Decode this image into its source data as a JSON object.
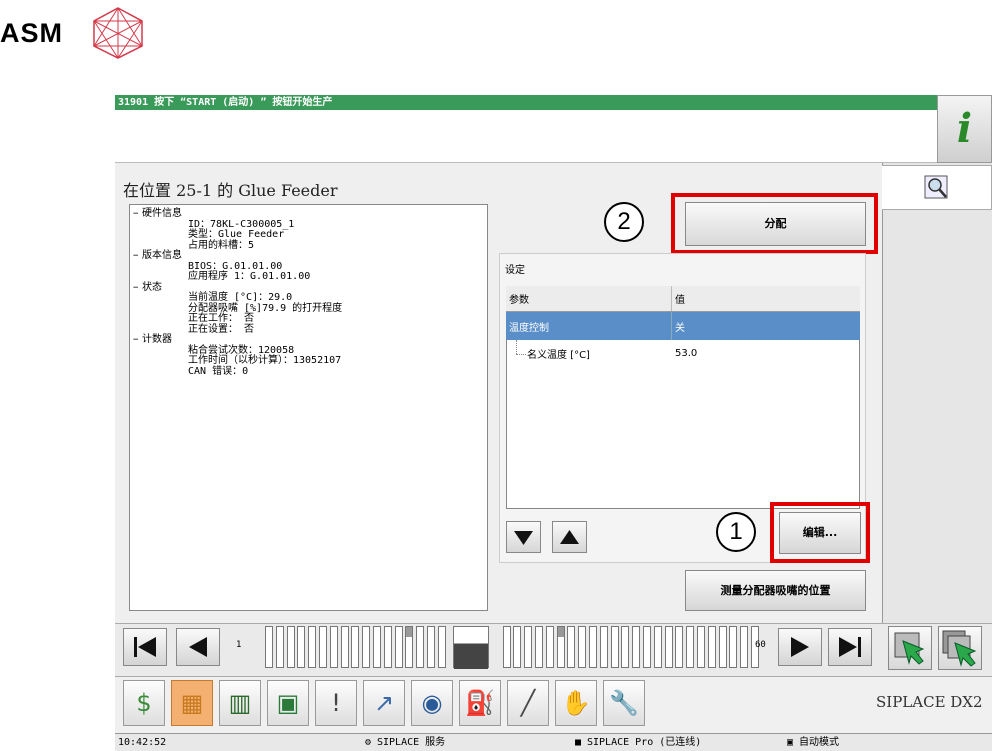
{
  "brand": {
    "name": "ASM"
  },
  "header": {
    "message": "31901 按下 “START (启动) ” 按钮开始生产"
  },
  "panel": {
    "title": "在位置 25-1 的 Glue Feeder"
  },
  "tree": [
    "硬件信息",
    "ID：78KL-C300005_1",
    "类型：Glue Feeder",
    "占用的料槽：5",
    "版本信息",
    "BIOS：G.01.01.00",
    "应用程序 1：G.01.01.00",
    "状态",
    "当前温度 [°C]：29.0",
    "分配器吸嘴 [%]79.9 的打开程度",
    "正在工作： 否",
    "正在设置： 否",
    "计数器",
    "粘合尝试次数：120058",
    "工作时间（以秒计算）：13052107",
    "CAN 错误：0"
  ],
  "buttons": {
    "assign": "分配",
    "edit": "编辑...",
    "measure": "测量分配器吸嘴的位置"
  },
  "callouts": {
    "one": "1",
    "two": "2"
  },
  "settings": {
    "label": "设定",
    "col_param": "参数",
    "col_value": "值",
    "rows": [
      {
        "param": "温度控制",
        "value": "关"
      },
      {
        "param": "名义温度 [°C]",
        "value": "53.0"
      }
    ]
  },
  "nav": {
    "first_slot": "1",
    "last_slot": "60"
  },
  "machine": {
    "name": "SIPLACE DX2"
  },
  "status": {
    "time": "10:42:52",
    "service": "SIPLACE 服务",
    "pro": "SIPLACE Pro (已连线)",
    "mode": "自动模式"
  },
  "colors": {
    "title_bar": "#3a9a5a",
    "selected_row": "#5a8ec8",
    "callout_border": "#e00000"
  }
}
